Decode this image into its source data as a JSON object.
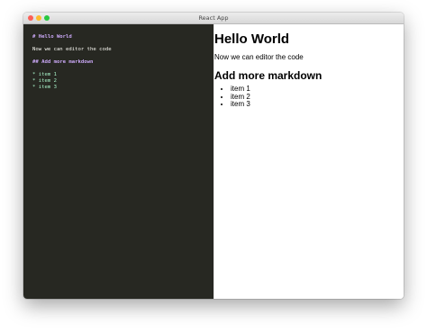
{
  "window": {
    "title": "React App",
    "controls": {
      "close_color": "#fc5f57",
      "minimize_color": "#fdbc2e",
      "zoom_color": "#28c840"
    }
  },
  "editor": {
    "background": "#272822",
    "lines": {
      "h1": "# Hello World",
      "p": "Now we can editor the code",
      "h2": "## Add more markdown",
      "items": [
        "* item 1",
        "* item 2",
        "* item 3"
      ]
    }
  },
  "preview": {
    "h1": "Hello World",
    "p": "Now we can editor the code",
    "h2": "Add more markdown",
    "items": [
      "item 1",
      "item 2",
      "item 3"
    ]
  }
}
